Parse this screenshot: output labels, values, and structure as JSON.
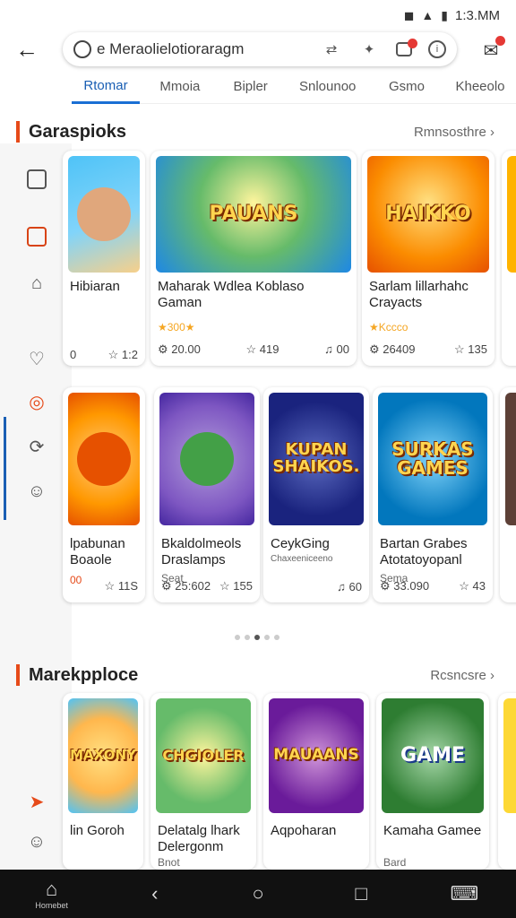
{
  "status_bar": {
    "time": "1:3.MM",
    "wifi_icon": "wifi-icon",
    "signal_icon": "signal-icon",
    "battery_icon": "battery-icon"
  },
  "urlbar": {
    "url": "e Meraolielotioraragm"
  },
  "tabs": [
    {
      "label": "Rtomar",
      "active": true
    },
    {
      "label": "Mmoia"
    },
    {
      "label": "Bipler"
    },
    {
      "label": "Snlounoo"
    },
    {
      "label": "Gsmo"
    },
    {
      "label": "Kheeolo"
    }
  ],
  "sections": [
    {
      "title": "Garaspioks",
      "more": "Rmnsosthre"
    },
    {
      "title": "Marekpploce",
      "more": "Rcsncsre"
    }
  ],
  "row1": [
    {
      "title": "Hibiaran",
      "stat1": "0",
      "stat2": "1:2",
      "art": "",
      "colors": [
        "#41b6e6",
        "#f7d08a"
      ]
    },
    {
      "title": "Maharak Wdlea Koblaso Gaman",
      "rating": "★300★",
      "stat1": "20.00",
      "stat2": "419",
      "stat3": "00",
      "art": "PAUANS",
      "colors": [
        "#4caf50",
        "#fdd835"
      ]
    },
    {
      "title": "Sarlam lillarhahc Crayacts",
      "rating": "★Kccco",
      "stat1": "26409",
      "stat2": "135",
      "art": "HAIKKO",
      "colors": [
        "#fb8c00",
        "#ffca28"
      ]
    }
  ],
  "row2": [
    {
      "title": "lpabunan Boaole",
      "sub": "00",
      "stat1": "",
      "stat2": "11S",
      "art": "",
      "colors": [
        "#ff9800",
        "#ffcc80"
      ]
    },
    {
      "title": "Bkaldolmeols Draslamps",
      "sub": "Seat",
      "stat1": "25:602",
      "stat2": "155",
      "art": "",
      "colors": [
        "#7e57c2",
        "#26a69a"
      ]
    },
    {
      "title": "CeykGing",
      "sub": "Chaxeeniceeno",
      "stat1": "",
      "stat2": "",
      "stat3": "60",
      "art": "KUPAN SHAIKOS.",
      "colors": [
        "#1a237e",
        "#3949ab"
      ]
    },
    {
      "title": "Bartan Grabes Atotatoyopanl",
      "sub": "Sema",
      "stat1": "33.090",
      "stat2": "43",
      "art": "SURKAS GAMES",
      "colors": [
        "#0277bd",
        "#4fc3f7"
      ]
    }
  ],
  "row3": [
    {
      "title": "lin Goroh",
      "sub": "",
      "art": "MAXONY",
      "colors": [
        "#ffb74d",
        "#4fc3f7"
      ]
    },
    {
      "title": "Delatalg lhark Delergonm",
      "sub": "Bnot",
      "art": "CHGIOLER",
      "colors": [
        "#66bb6a",
        "#ffee58"
      ]
    },
    {
      "title": "Aqpoharan",
      "sub": "",
      "art": "MAUAANS",
      "colors": [
        "#6a1b9a",
        "#ab47bc"
      ]
    },
    {
      "title": "Kamaha Gamee",
      "sub": "Bard",
      "art": "GAME",
      "colors": [
        "#2e7d32",
        "#81c784"
      ]
    }
  ],
  "bottom_nav": {
    "home_label": "Homebet"
  }
}
